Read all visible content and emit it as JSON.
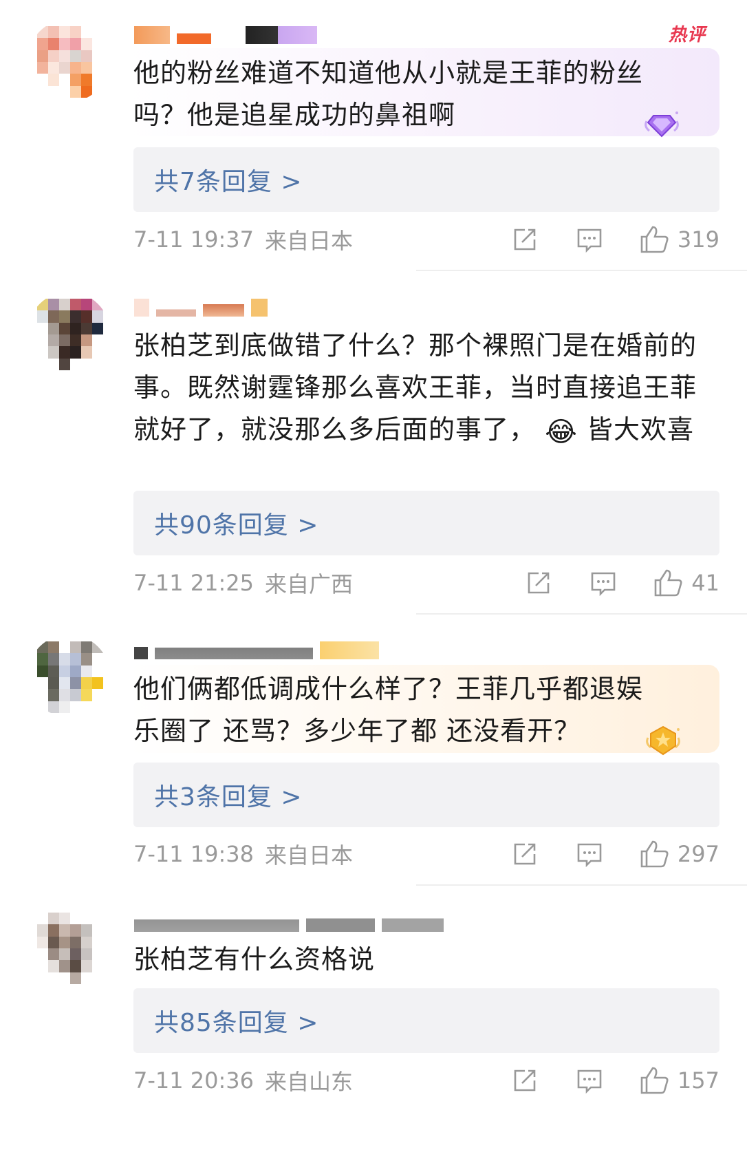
{
  "comments": [
    {
      "hot_tag": "热评",
      "text": "他的粉丝难道不知道他从小就是王菲的粉丝吗？他是追星成功的鼻祖啊",
      "reply_label": "共7条回复 >",
      "time": "7-11 19:37",
      "location": "来自日本",
      "likes": "319",
      "bubble": "purple"
    },
    {
      "text_before_emoji": "张柏芝到底做错了什么？那个裸照门是在婚前的事。既然谢霆锋那么喜欢王菲，当时直接追王菲就好了，就没那么多后面的事了，",
      "emoji": "😂",
      "text_after_emoji": "皆大欢喜",
      "reply_label": "共90条回复 >",
      "time": "7-11 21:25",
      "location": "来自广西",
      "likes": "41"
    },
    {
      "text": "他们俩都低调成什么样了？王菲几乎都退娱乐圈了 还骂？多少年了都 还没看开？",
      "reply_label": "共3条回复 >",
      "time": "7-11 19:38",
      "location": "来自日本",
      "likes": "297",
      "bubble": "orange"
    },
    {
      "text": "张柏芝有什么资格说",
      "reply_label": "共85条回复 >",
      "time": "7-11 20:36",
      "location": "来自山东",
      "likes": "157"
    }
  ],
  "icons": {
    "share": "share-icon",
    "comment": "comment-icon",
    "like": "thumbs-up-icon",
    "badge_purple": "diamond-badge-icon",
    "badge_orange": "gold-badge-icon"
  },
  "colors": {
    "reply_link": "#4f74a8",
    "meta_gray": "#9a9a9a",
    "hot_tag": "#e8374f",
    "reply_bg": "#f2f2f4"
  }
}
